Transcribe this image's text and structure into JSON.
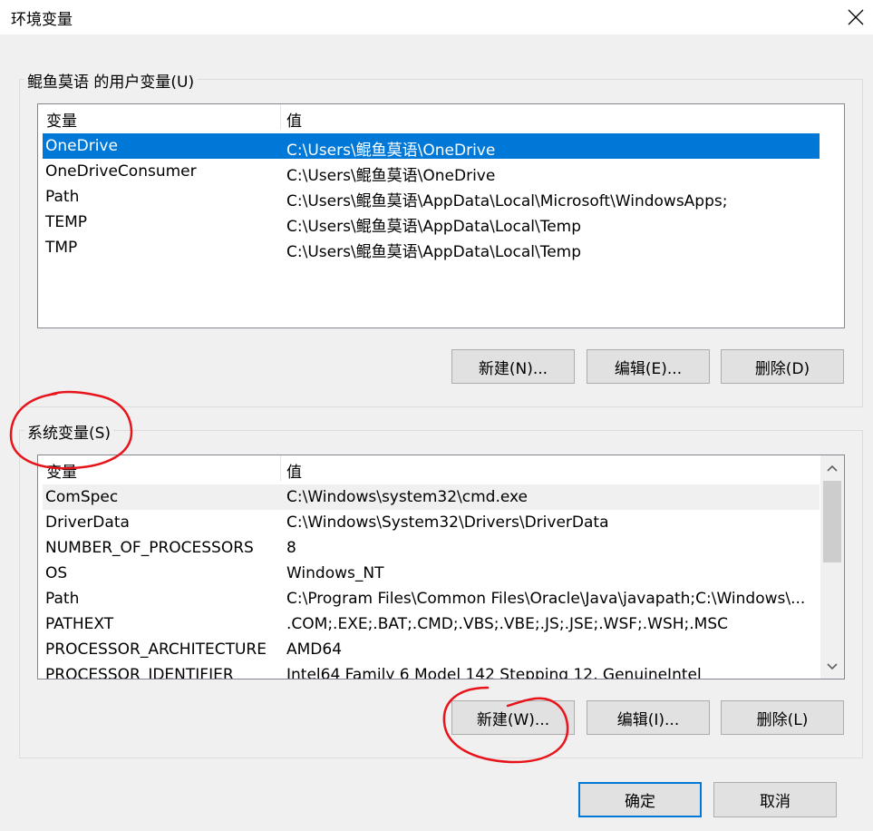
{
  "window": {
    "title": "环境变量",
    "close_icon": "close-icon"
  },
  "user_vars": {
    "label": "鲲鱼莫语 的用户变量(U)",
    "headers": [
      "变量",
      "值"
    ],
    "rows": [
      {
        "name": "OneDrive",
        "value": "C:\\Users\\鲲鱼莫语\\OneDrive"
      },
      {
        "name": "OneDriveConsumer",
        "value": "C:\\Users\\鲲鱼莫语\\OneDrive"
      },
      {
        "name": "Path",
        "value": "C:\\Users\\鲲鱼莫语\\AppData\\Local\\Microsoft\\WindowsApps;"
      },
      {
        "name": "TEMP",
        "value": "C:\\Users\\鲲鱼莫语\\AppData\\Local\\Temp"
      },
      {
        "name": "TMP",
        "value": "C:\\Users\\鲲鱼莫语\\AppData\\Local\\Temp"
      }
    ],
    "selected_row": "OneDrive",
    "buttons": {
      "new": "新建(N)...",
      "edit": "编辑(E)...",
      "delete": "删除(D)"
    }
  },
  "system_vars": {
    "label": "系统变量(S)",
    "headers": [
      "变量",
      "值"
    ],
    "rows": [
      {
        "name": "ComSpec",
        "value": "C:\\Windows\\system32\\cmd.exe"
      },
      {
        "name": "DriverData",
        "value": "C:\\Windows\\System32\\Drivers\\DriverData"
      },
      {
        "name": "NUMBER_OF_PROCESSORS",
        "value": "8"
      },
      {
        "name": "OS",
        "value": "Windows_NT"
      },
      {
        "name": "Path",
        "value": "C:\\Program Files\\Common Files\\Oracle\\Java\\javapath;C:\\Windows\\..."
      },
      {
        "name": "PATHEXT",
        "value": ".COM;.EXE;.BAT;.CMD;.VBS;.VBE;.JS;.JSE;.WSF;.WSH;.MSC"
      },
      {
        "name": "PROCESSOR_ARCHITECTURE",
        "value": "AMD64"
      },
      {
        "name": "PROCESSOR_IDENTIFIER",
        "value": "Intel64 Family 6 Model 142 Stepping 12, GenuineIntel"
      }
    ],
    "buttons": {
      "new": "新建(W)...",
      "edit": "编辑(I)...",
      "delete": "删除(L)"
    }
  },
  "footer": {
    "ok": "确定",
    "cancel": "取消"
  },
  "colors": {
    "selection": "#0078d7",
    "annotation": "#e8141b"
  }
}
